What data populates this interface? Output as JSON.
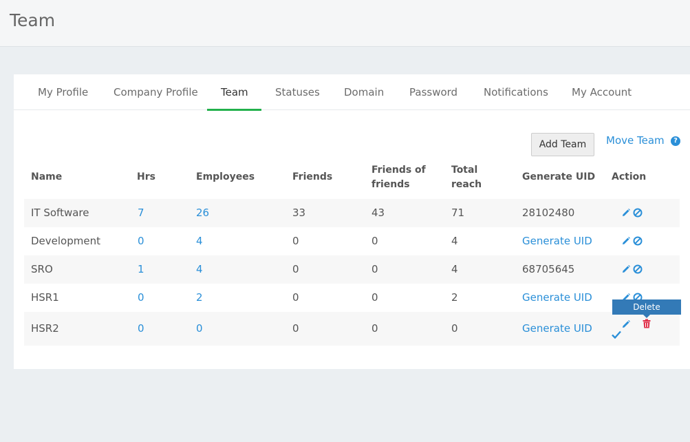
{
  "header": {
    "title": "Team"
  },
  "tabs": [
    {
      "label": "My Profile"
    },
    {
      "label": "Company Profile"
    },
    {
      "label": "Team"
    },
    {
      "label": "Statuses"
    },
    {
      "label": "Domain"
    },
    {
      "label": "Password"
    },
    {
      "label": "Notifications"
    },
    {
      "label": "My Account"
    }
  ],
  "active_tab": "Team",
  "toolbar": {
    "add_team_label": "Add Team",
    "move_team_label": "Move Team",
    "help_glyph": "?"
  },
  "table": {
    "headers": {
      "name": "Name",
      "hrs": "Hrs",
      "employees": "Employees",
      "friends": "Friends",
      "fof_line1": "Friends of",
      "fof_line2": "friends",
      "reach_line1": "Total",
      "reach_line2": "reach",
      "uid": "Generate UID",
      "action": "Action"
    },
    "rows": [
      {
        "name": "IT Software",
        "hrs": "7",
        "employees": "26",
        "friends": "33",
        "fof": "43",
        "reach": "71",
        "uid": "28102480",
        "uid_is_link": false
      },
      {
        "name": "Development",
        "hrs": "0",
        "employees": "4",
        "friends": "0",
        "fof": "0",
        "reach": "4",
        "uid": "Generate UID",
        "uid_is_link": true
      },
      {
        "name": "SRO",
        "hrs": "1",
        "employees": "4",
        "friends": "0",
        "fof": "0",
        "reach": "4",
        "uid": "68705645",
        "uid_is_link": false
      },
      {
        "name": "HSR1",
        "hrs": "0",
        "employees": "2",
        "friends": "0",
        "fof": "0",
        "reach": "2",
        "uid": "Generate UID",
        "uid_is_link": true
      },
      {
        "name": "HSR2",
        "hrs": "0",
        "employees": "0",
        "friends": "0",
        "fof": "0",
        "reach": "0",
        "uid": "Generate UID",
        "uid_is_link": true
      }
    ]
  },
  "tooltip": {
    "text": "Delete"
  },
  "colors": {
    "accent": "#2a8fd8",
    "active_tab": "#22b14c",
    "danger": "#e0314b",
    "tooltip_bg": "#337ab7"
  },
  "icons": {
    "edit": "pencil-icon",
    "disable": "ban-icon",
    "delete": "trash-icon",
    "confirm": "check-icon"
  }
}
